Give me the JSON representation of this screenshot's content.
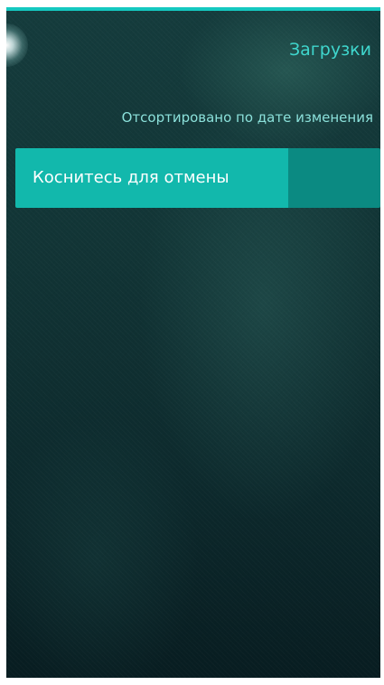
{
  "header": {
    "title": "Загрузки"
  },
  "list": {
    "sort_label": "Отсортировано по дате изменения",
    "items": [
      {
        "label": "Коснитесь для отмены",
        "progress": 0.75
      }
    ]
  },
  "colors": {
    "accent": "#15c8c0",
    "title_text": "#3fd6cd",
    "secondary_text": "#8be0da",
    "progress_fill": "#12b8ac",
    "progress_track": "#0b8a82"
  },
  "icons": {
    "corner_glow": "glow-icon"
  }
}
